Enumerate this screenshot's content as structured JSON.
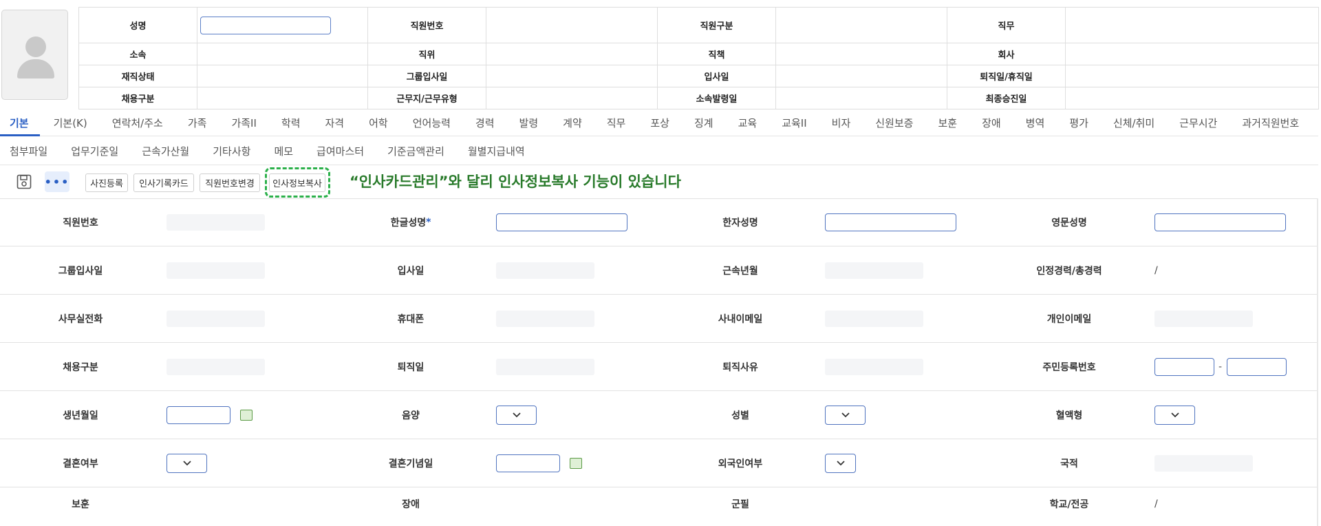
{
  "header": {
    "rows": [
      [
        {
          "label": "성명"
        },
        {
          "label": "직원번호"
        },
        {
          "label": "직원구분"
        },
        {
          "label": "직무"
        }
      ],
      [
        {
          "label": "소속"
        },
        {
          "label": "직위"
        },
        {
          "label": "직책"
        },
        {
          "label": "회사"
        }
      ],
      [
        {
          "label": "재직상태"
        },
        {
          "label": "그룹입사일"
        },
        {
          "label": "입사일"
        },
        {
          "label": "퇴직일/휴직일"
        }
      ],
      [
        {
          "label": "채용구분"
        },
        {
          "label": "근무지/근무유형"
        },
        {
          "label": "소속발령일"
        },
        {
          "label": "최종승진일"
        }
      ]
    ]
  },
  "tabs_primary": [
    "기본",
    "기본(K)",
    "연락처/주소",
    "가족",
    "가족II",
    "학력",
    "자격",
    "어학",
    "언어능력",
    "경력",
    "발령",
    "계약",
    "직무",
    "포상",
    "징계",
    "교육",
    "교육II",
    "비자",
    "신원보증",
    "보훈",
    "장애",
    "병역",
    "평가",
    "신체/취미",
    "근무시간",
    "과거직원번호"
  ],
  "tabs_secondary": [
    "첨부파일",
    "업무기준일",
    "근속가산월",
    "기타사항",
    "메모",
    "급여마스터",
    "기준금액관리",
    "월별지급내역"
  ],
  "toolbar": {
    "buttons": [
      "사진등록",
      "인사기록카드",
      "직원번호변경",
      "인사정보복사"
    ],
    "more_label": "•••",
    "annotation": "“인사카드관리”와 달리 인사정보복사 기능이 있습니다"
  },
  "form": {
    "row1": [
      "직원번호",
      "한글성명",
      "한자성명",
      "영문성명"
    ],
    "required_mark": "*",
    "row2": [
      "그룹입사일",
      "입사일",
      "근속년월",
      "인정경력/총경력"
    ],
    "row3": [
      "사무실전화",
      "휴대폰",
      "사내이메일",
      "개인이메일"
    ],
    "row4": [
      "채용구분",
      "퇴직일",
      "퇴직사유",
      "주민등록번호"
    ],
    "row5": [
      "생년월일",
      "음양",
      "성별",
      "혈액형"
    ],
    "row6": [
      "결혼여부",
      "결혼기념일",
      "외국인여부",
      "국적"
    ],
    "row7": [
      "보훈",
      "장애",
      "군필",
      "학교/전공"
    ],
    "career_value": "/",
    "school_value": "/",
    "rrn_separator": "-"
  },
  "colors": {
    "accent": "#2a5fc4",
    "annotation": "#287a2a",
    "highlight_border": "#2bb04a"
  }
}
